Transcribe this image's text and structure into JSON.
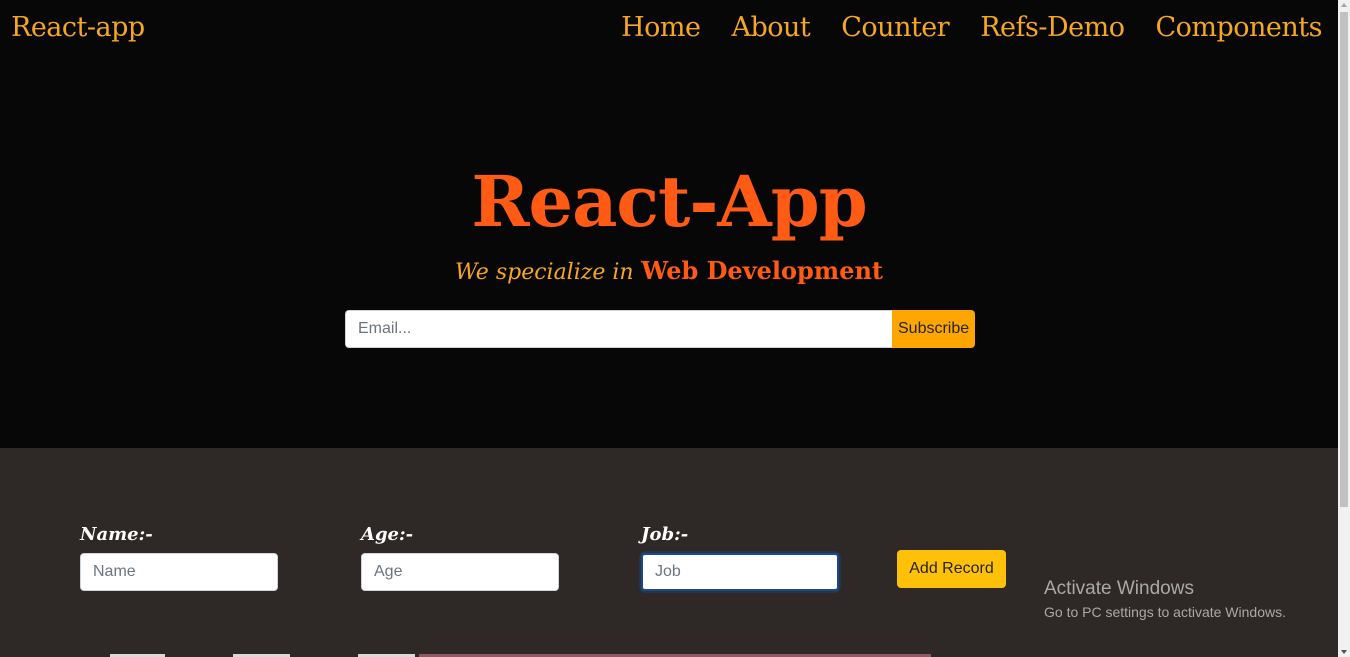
{
  "header": {
    "brand": "React-app",
    "nav": [
      "Home",
      "About",
      "Counter",
      "Refs-Demo",
      "Components"
    ]
  },
  "hero": {
    "title": "React-App",
    "tagline_lead": "We specialize in",
    "tagline_emphasis": "Web Development",
    "email_placeholder": "Email...",
    "subscribe_label": "Subscribe"
  },
  "records": {
    "name_label": "Name:-",
    "name_placeholder": "Name",
    "age_label": "Age:-",
    "age_placeholder": "Age",
    "job_label": "Job:-",
    "job_placeholder": "Job",
    "add_label": "Add Record"
  },
  "watermark": {
    "title": "Activate Windows",
    "subtitle": "Go to PC settings to activate Windows."
  },
  "colors": {
    "nav_text": "#f5a623",
    "hero_title": "#ff5b14",
    "subscribe_button": "#ffa500",
    "add_button": "#ffc107",
    "hero_background": "#080708",
    "records_background": "#2e2826"
  }
}
